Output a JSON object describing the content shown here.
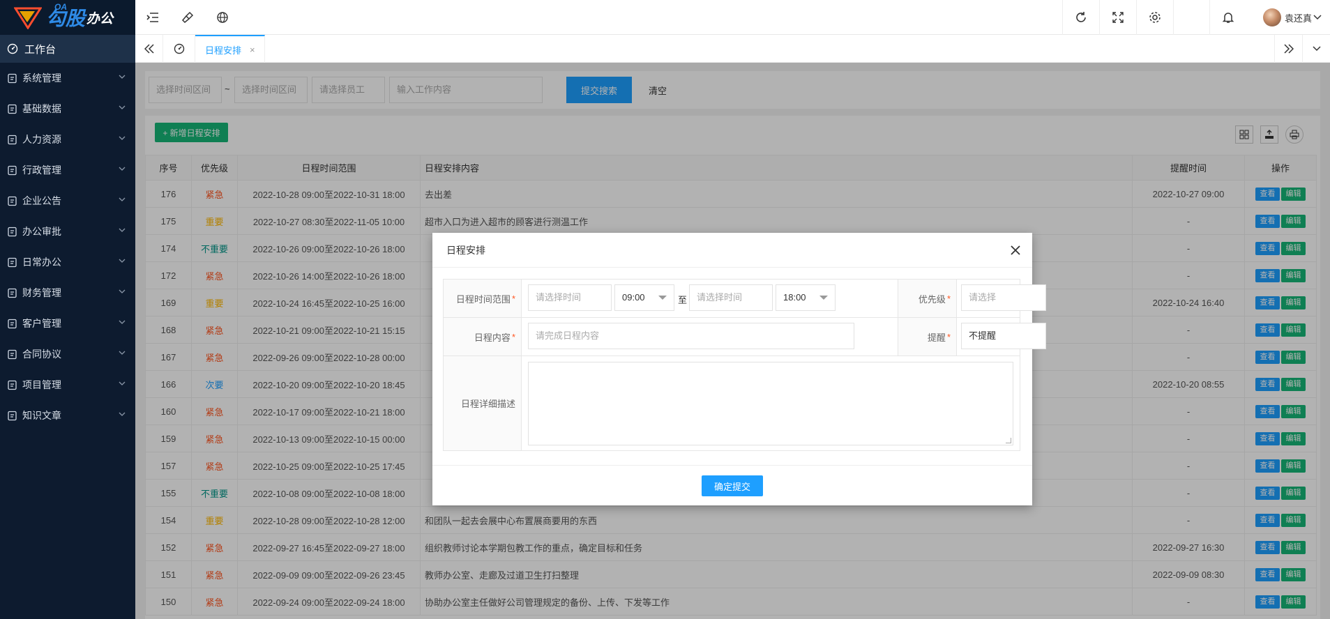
{
  "app": {
    "logo_oa": "OA",
    "logo_main": "勾股",
    "logo_sub": "办公"
  },
  "sidebar": {
    "active_label": "工作台",
    "items": [
      {
        "label": "系统管理",
        "icon": "gear-icon"
      },
      {
        "label": "基础数据",
        "icon": "database-icon"
      },
      {
        "label": "人力资源",
        "icon": "person-card-icon"
      },
      {
        "label": "行政管理",
        "icon": "admin-icon"
      },
      {
        "label": "企业公告",
        "icon": "bell-icon"
      },
      {
        "label": "办公审批",
        "icon": "approval-icon"
      },
      {
        "label": "日常办公",
        "icon": "calendar-icon"
      },
      {
        "label": "财务管理",
        "icon": "finance-icon"
      },
      {
        "label": "客户管理",
        "icon": "customer-icon"
      },
      {
        "label": "合同协议",
        "icon": "contract-icon"
      },
      {
        "label": "项目管理",
        "icon": "project-icon"
      },
      {
        "label": "知识文章",
        "icon": "article-icon"
      }
    ]
  },
  "topbar": {
    "user_name": "袁还真"
  },
  "tabs": {
    "active_label": "日程安排",
    "close": "×"
  },
  "search": {
    "start_placeholder": "选择时间区间",
    "tilde": "~",
    "end_placeholder": "选择时间区间",
    "employee_placeholder": "请选择员工",
    "content_placeholder": "输入工作内容",
    "submit_label": "提交搜索",
    "clear_label": "清空"
  },
  "table": {
    "add_label": "+ 新增日程安排",
    "columns": [
      "序号",
      "优先级",
      "日程时间范围",
      "日程安排内容",
      "提醒时间",
      "操作"
    ],
    "view_label": "查看",
    "edit_label": "编辑",
    "rows": [
      {
        "id": "176",
        "priority": "紧急",
        "pcolor": "#ff5722",
        "range": "2022-10-28 09:00至2022-10-31 18:00",
        "content": "去出差",
        "remind": "2022-10-27 09:00"
      },
      {
        "id": "175",
        "priority": "重要",
        "pcolor": "#ffb800",
        "range": "2022-10-27 08:30至2022-11-05 10:00",
        "content": "超市入口为进入超市的顾客进行测温工作",
        "remind": "-"
      },
      {
        "id": "174",
        "priority": "不重要",
        "pcolor": "#009688",
        "range": "2022-10-26 09:00至2022-10-26 18:00",
        "content": "",
        "remind": "-"
      },
      {
        "id": "172",
        "priority": "紧急",
        "pcolor": "#ff5722",
        "range": "2022-10-26 14:00至2022-10-26 18:00",
        "content": "",
        "remind": "-"
      },
      {
        "id": "169",
        "priority": "重要",
        "pcolor": "#ffb800",
        "range": "2022-10-24 16:45至2022-10-25 16:00",
        "content": "",
        "remind": "2022-10-24 16:40"
      },
      {
        "id": "168",
        "priority": "紧急",
        "pcolor": "#ff5722",
        "range": "2022-10-21 09:00至2022-10-21 15:15",
        "content": "",
        "remind": "-"
      },
      {
        "id": "167",
        "priority": "紧急",
        "pcolor": "#ff5722",
        "range": "2022-09-26 09:00至2022-10-28 00:00",
        "content": "",
        "remind": "-"
      },
      {
        "id": "166",
        "priority": "次要",
        "pcolor": "#1e9fff",
        "range": "2022-10-20 09:00至2022-10-20 18:45",
        "content": "",
        "remind": "2022-10-20 08:55"
      },
      {
        "id": "160",
        "priority": "紧急",
        "pcolor": "#ff5722",
        "range": "2022-10-17 09:00至2022-10-21 18:00",
        "content": "",
        "remind": "-"
      },
      {
        "id": "159",
        "priority": "紧急",
        "pcolor": "#ff5722",
        "range": "2022-10-13 09:00至2022-10-15 00:00",
        "content": "",
        "remind": "-"
      },
      {
        "id": "157",
        "priority": "紧急",
        "pcolor": "#ff5722",
        "range": "2022-10-25 09:00至2022-10-25 17:45",
        "content": "",
        "remind": "-"
      },
      {
        "id": "155",
        "priority": "不重要",
        "pcolor": "#009688",
        "range": "2022-10-08 09:00至2022-10-08 18:00",
        "content": "",
        "remind": "-"
      },
      {
        "id": "154",
        "priority": "重要",
        "pcolor": "#ffb800",
        "range": "2022-10-28 09:00至2022-10-28 12:00",
        "content": "和团队一起去会展中心布置展商要用的东西",
        "remind": "-"
      },
      {
        "id": "152",
        "priority": "紧急",
        "pcolor": "#ff5722",
        "range": "2022-09-27 16:45至2022-09-27 18:00",
        "content": "组织教师讨论本学期包教工作的重点，确定目标和任务",
        "remind": "2022-09-27 16:30"
      },
      {
        "id": "151",
        "priority": "紧急",
        "pcolor": "#ff5722",
        "range": "2022-09-09 09:00至2022-09-26 23:45",
        "content": "教师办公室、走廊及过道卫生打扫整理",
        "remind": "2022-09-09 08:30"
      },
      {
        "id": "150",
        "priority": "紧急",
        "pcolor": "#ff5722",
        "range": "2022-09-24 09:00至2022-09-24 18:00",
        "content": "协助办公室主任做好公司管理规定的备份、上传、下发等工作",
        "remind": "-"
      }
    ]
  },
  "modal": {
    "title": "日程安排",
    "range_label": "日程时间范围",
    "start_date_placeholder": "请选择时间",
    "start_time": "09:00",
    "to": "至",
    "end_date_placeholder": "请选择时间",
    "end_time": "18:00",
    "priority_label": "优先级",
    "priority_placeholder": "请选择",
    "content_label": "日程内容",
    "content_placeholder": "请完成日程内容",
    "remind_label": "提醒",
    "remind_value": "不提醒",
    "detail_label": "日程详细描述",
    "required_mark": "*",
    "submit_label": "确定提交"
  },
  "colors": {
    "sidebar_bg": "#0d1b2f",
    "primary": "#1e9fff",
    "success": "#16b777",
    "urgent": "#ff5722",
    "important": "#ffb800",
    "minor": "#009688"
  }
}
